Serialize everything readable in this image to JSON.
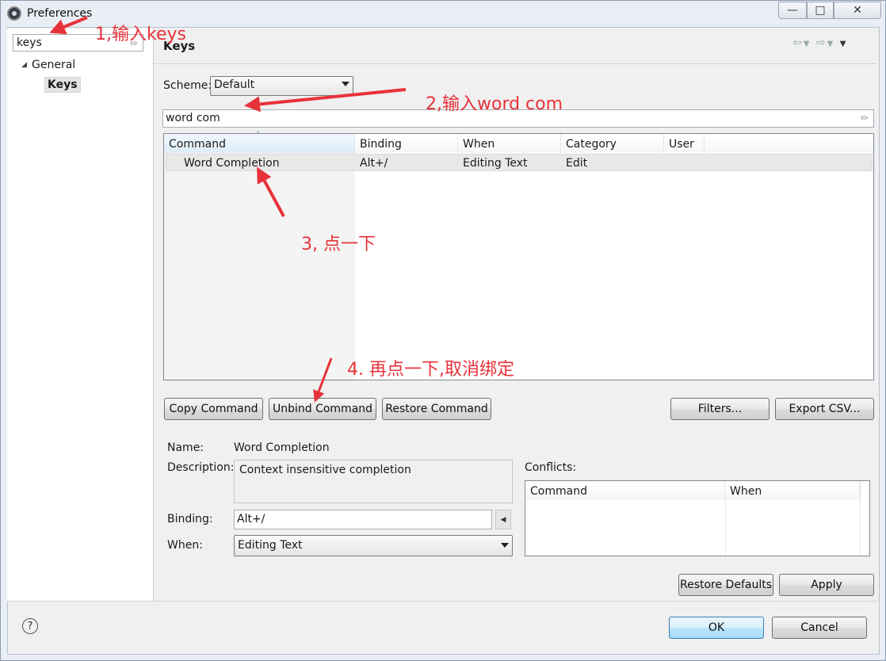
{
  "window": {
    "title": "Preferences"
  },
  "sidebar": {
    "search_value": "keys",
    "tree": [
      {
        "label": "General"
      },
      {
        "label": "Keys"
      }
    ]
  },
  "page": {
    "title": "Keys",
    "scheme_label": "Scheme:",
    "scheme_value": "Default",
    "filter_value": "word com"
  },
  "table": {
    "columns": [
      "Command",
      "Binding",
      "When",
      "Category",
      "User"
    ],
    "rows": [
      {
        "command": "Word Completion",
        "binding": "Alt+/",
        "when": "Editing Text",
        "category": "Edit",
        "user": ""
      }
    ]
  },
  "buttons": {
    "copy_command": "Copy Command",
    "unbind_command": "Unbind Command",
    "restore_command": "Restore Command",
    "filters": "Filters...",
    "export_csv": "Export CSV...",
    "restore_defaults": "Restore Defaults",
    "apply": "Apply",
    "ok": "OK",
    "cancel": "Cancel"
  },
  "details": {
    "name_label": "Name:",
    "name_value": "Word Completion",
    "description_label": "Description:",
    "description_value": "Context insensitive completion",
    "binding_label": "Binding:",
    "binding_value": "Alt+/",
    "when_label": "When:",
    "when_value": "Editing Text",
    "conflicts_label": "Conflicts:",
    "conflicts_columns": [
      "Command",
      "When"
    ]
  },
  "annotations": {
    "step1": "1,输入keys",
    "step2": "2,输入word com",
    "step3": "3, 点一下",
    "step4": "4. 再点一下,取消绑定"
  },
  "colors": {
    "annotation": "#e8323a",
    "selected_row": "#e8e8e8",
    "default_button": "#3c7fb1"
  }
}
